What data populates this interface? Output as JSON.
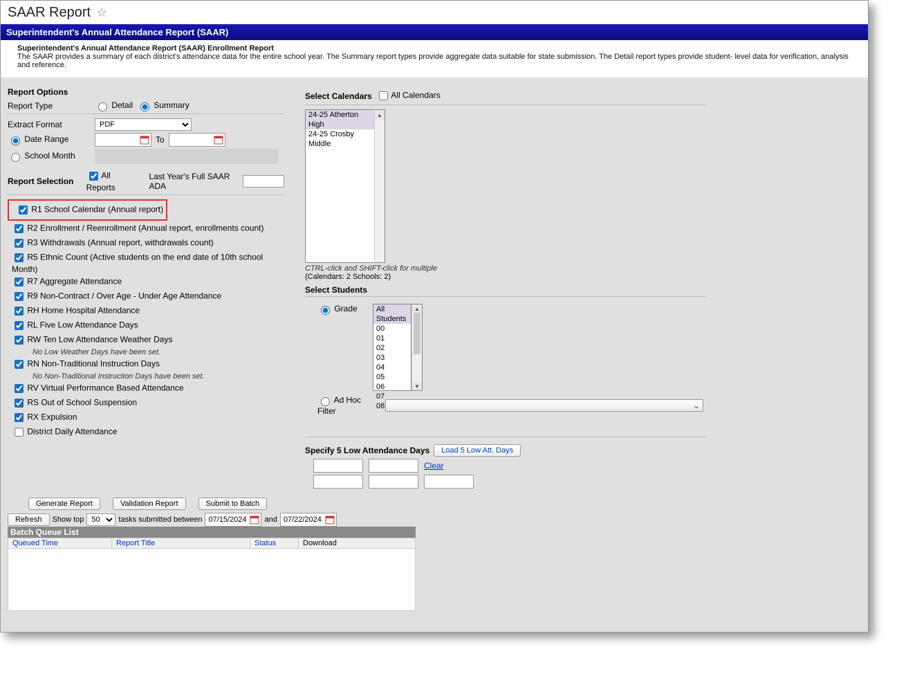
{
  "header": {
    "title": "SAAR Report"
  },
  "blueBar": "Superintendent's Annual Attendance Report (SAAR)",
  "desc": {
    "sub": "Superintendent's Annual Attendance Report (SAAR) Enrollment Report",
    "body": "The SAAR provides a summary of each district's attendance data for the entire school year. The Summary report types provide aggregate data suitable for state submission. The Detail report types provide student- level data for verification, analysis and reference."
  },
  "left": {
    "title": "Report Options",
    "reportType": {
      "label": "Report Type",
      "opt1": "Detail",
      "opt2": "Summary"
    },
    "extract": {
      "label": "Extract Format",
      "value": "PDF"
    },
    "dateRange": {
      "label": "Date Range",
      "to": "To"
    },
    "schoolMonth": {
      "label": "School Month"
    },
    "reportSel": {
      "label": "Report Selection",
      "all": "All Reports",
      "ada": "Last Year's Full SAAR ADA"
    },
    "items": [
      {
        "id": "r1",
        "label": "R1 School Calendar (Annual report)",
        "checked": true,
        "highlight": true
      },
      {
        "id": "r2",
        "label": "R2 Enrollment / Reenrollment (Annual report, enrollments count)",
        "checked": true
      },
      {
        "id": "r3",
        "label": "R3 Withdrawals (Annual report, withdrawals count)",
        "checked": true
      },
      {
        "id": "r5",
        "label": "R5 Ethnic Count (Active students on the end date of 10th school Month)",
        "checked": true
      },
      {
        "id": "r7",
        "label": "R7 Aggregate Attendance",
        "checked": true
      },
      {
        "id": "r9",
        "label": "R9 Non-Contract / Over Age - Under Age Attendance",
        "checked": true
      },
      {
        "id": "rh",
        "label": "RH Home Hospital Attendance",
        "checked": true
      },
      {
        "id": "rl",
        "label": "RL Five Low Attendance Days",
        "checked": true
      },
      {
        "id": "rw",
        "label": "RW Ten Low Attendance Weather Days",
        "checked": true,
        "note": "No Low Weather Days have been set."
      },
      {
        "id": "rn",
        "label": "RN Non-Traditional Instruction Days",
        "checked": true,
        "note": "No Non-Traditional Instruction Days have been set."
      },
      {
        "id": "rv",
        "label": "RV Virtual Performance Based Attendance",
        "checked": true
      },
      {
        "id": "rs",
        "label": "RS Out of School Suspension",
        "checked": true
      },
      {
        "id": "rx",
        "label": "RX Expulsion",
        "checked": true
      },
      {
        "id": "dd",
        "label": "District Daily Attendance",
        "checked": false
      }
    ]
  },
  "right": {
    "selCalLabel": "Select Calendars",
    "allCal": "All Calendars",
    "calendars": [
      "24-25 Atherton High",
      "24-25 Crosby Middle"
    ],
    "calHint": "CTRL-click and SHIFT-click for multiple",
    "calCount": "(Calendars: 2  Schools: 2)",
    "selStudents": "Select Students",
    "gradeLabel": "Grade",
    "grades": [
      "All Students",
      "00",
      "01",
      "02",
      "03",
      "04",
      "05",
      "06",
      "07",
      "08"
    ],
    "adHoc": "Ad Hoc Filter",
    "specify": "Specify 5 Low Attendance Days",
    "loadBtn": "Load 5 Low Att. Days",
    "clear": "Clear"
  },
  "bottom": {
    "gen": "Generate Report",
    "val": "Validation Report",
    "sub": "Submit to Batch",
    "refresh": "Refresh",
    "showTop": "Show top",
    "showVal": "50",
    "between": "tasks submitted between",
    "d1": "07/15/2024",
    "and": "and",
    "d2": "07/22/2024",
    "queue": "Batch Queue List",
    "h1": "Queued Time",
    "h2": "Report Title",
    "h3": "Status",
    "h4": "Download"
  }
}
